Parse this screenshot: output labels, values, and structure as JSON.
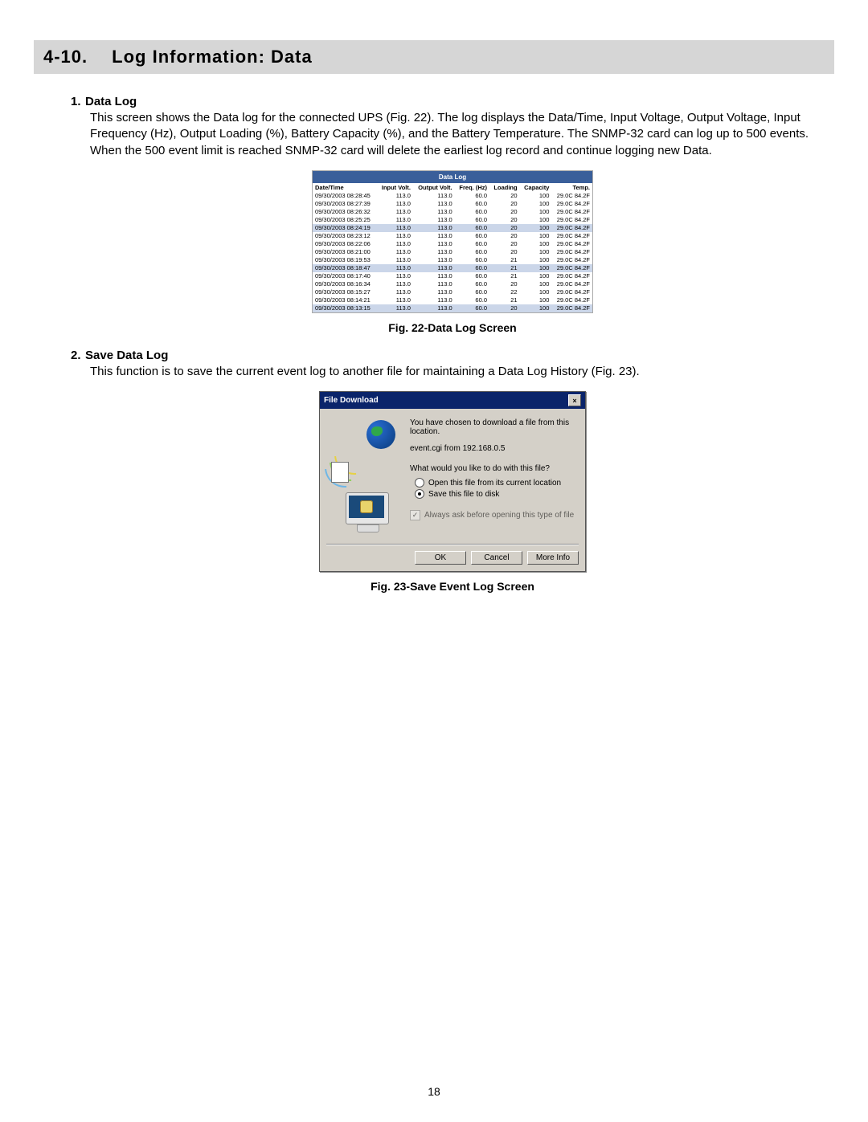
{
  "header": {
    "num": "4-10.",
    "title": "Log Information: Data"
  },
  "section1": {
    "num": "1.",
    "title": "Data Log",
    "body": "This screen shows the Data log for the connected UPS (Fig. 22).  The log displays the Data/Time, Input Voltage, Output Voltage, Input Frequency (Hz), Output Loading (%), Battery Capacity (%), and the Battery Temperature.  The SNMP-32 card can log up to 500 events.  When the 500 event limit is reached SNMP-32 card will delete the earliest log record and continue logging new Data."
  },
  "fig22_caption": "Fig. 22-Data Log Screen",
  "section2": {
    "num": "2.",
    "title": "Save Data Log",
    "body": "This function is to save the current event log to another file for maintaining a Data Log History (Fig. 23)."
  },
  "fig23_caption": "Fig. 23-Save Event Log Screen",
  "page_num": "18",
  "datalog": {
    "title": "Data Log",
    "headers": [
      "Date/Time",
      "Input Volt.",
      "Output Volt.",
      "Freq. (Hz)",
      "Loading",
      "Capacity",
      "Temp."
    ],
    "rows": [
      [
        "09/30/2003 08:28:45",
        "113.0",
        "113.0",
        "60.0",
        "20",
        "100",
        "29.0C 84.2F"
      ],
      [
        "09/30/2003 08:27:39",
        "113.0",
        "113.0",
        "60.0",
        "20",
        "100",
        "29.0C 84.2F"
      ],
      [
        "09/30/2003 08:26:32",
        "113.0",
        "113.0",
        "60.0",
        "20",
        "100",
        "29.0C 84.2F"
      ],
      [
        "09/30/2003 08:25:25",
        "113.0",
        "113.0",
        "60.0",
        "20",
        "100",
        "29.0C 84.2F"
      ],
      [
        "09/30/2003 08:24:19",
        "113.0",
        "113.0",
        "60.0",
        "20",
        "100",
        "29.0C 84.2F"
      ],
      [
        "09/30/2003 08:23:12",
        "113.0",
        "113.0",
        "60.0",
        "20",
        "100",
        "29.0C 84.2F"
      ],
      [
        "09/30/2003 08:22:06",
        "113.0",
        "113.0",
        "60.0",
        "20",
        "100",
        "29.0C 84.2F"
      ],
      [
        "09/30/2003 08:21:00",
        "113.0",
        "113.0",
        "60.0",
        "20",
        "100",
        "29.0C 84.2F"
      ],
      [
        "09/30/2003 08:19:53",
        "113.0",
        "113.0",
        "60.0",
        "21",
        "100",
        "29.0C 84.2F"
      ],
      [
        "09/30/2003 08:18:47",
        "113.0",
        "113.0",
        "60.0",
        "21",
        "100",
        "29.0C 84.2F"
      ],
      [
        "09/30/2003 08:17:40",
        "113.0",
        "113.0",
        "60.0",
        "21",
        "100",
        "29.0C 84.2F"
      ],
      [
        "09/30/2003 08:16:34",
        "113.0",
        "113.0",
        "60.0",
        "20",
        "100",
        "29.0C 84.2F"
      ],
      [
        "09/30/2003 08:15:27",
        "113.0",
        "113.0",
        "60.0",
        "22",
        "100",
        "29.0C 84.2F"
      ],
      [
        "09/30/2003 08:14:21",
        "113.0",
        "113.0",
        "60.0",
        "21",
        "100",
        "29.0C 84.2F"
      ],
      [
        "09/30/2003 08:13:15",
        "113.0",
        "113.0",
        "60.0",
        "20",
        "100",
        "29.0C 84.2F"
      ]
    ]
  },
  "dialog": {
    "title": "File Download",
    "line1": "You have chosen to download a file from this location.",
    "line2": "event.cgi from 192.168.0.5",
    "question": "What would you like to do with this file?",
    "opt1": "Open this file from its current location",
    "opt2": "Save this file to disk",
    "checkbox": "Always ask before opening this type of file",
    "btn_ok": "OK",
    "btn_cancel": "Cancel",
    "btn_more": "More Info"
  }
}
